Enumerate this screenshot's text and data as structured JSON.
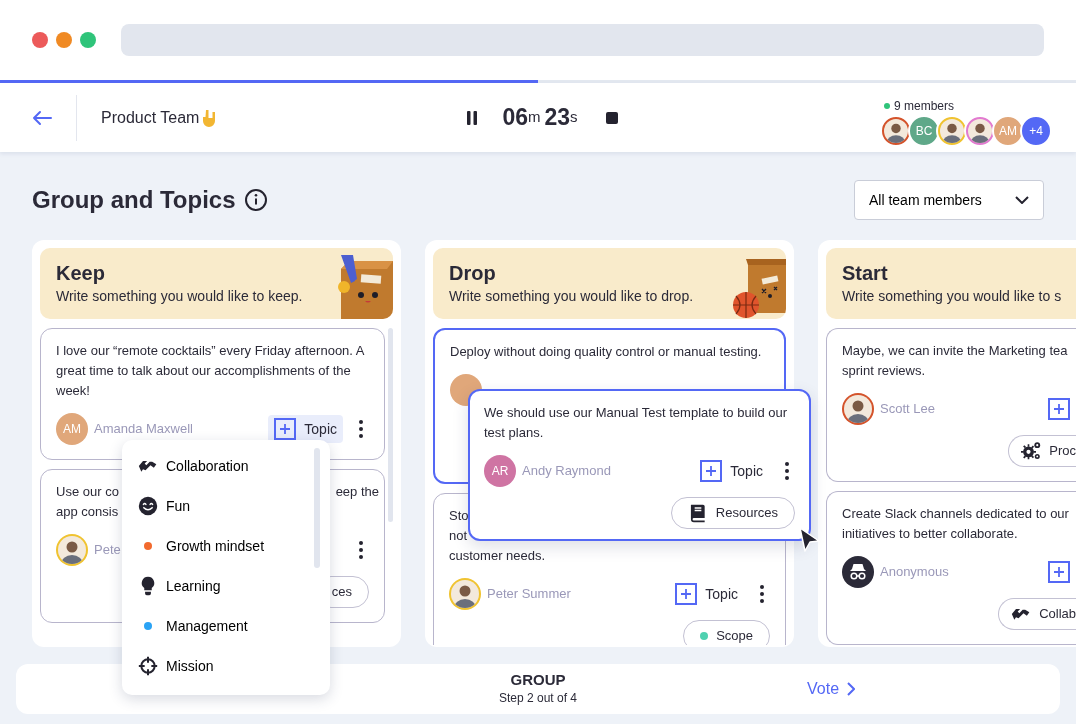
{
  "browser": {
    "dots": [
      {
        "color": "#ec5a5a"
      },
      {
        "color": "#f08a24"
      },
      {
        "color": "#2fc47a"
      }
    ]
  },
  "progress": {
    "level": 0.5
  },
  "header": {
    "title": "Product Team",
    "timer": {
      "minutes": "06",
      "minutes_unit": "m",
      "seconds": "23",
      "seconds_unit": "s"
    },
    "members": {
      "label": "9 members",
      "avatars": [
        {
          "kind": "photo",
          "color": "#d4532b"
        },
        {
          "kind": "initials",
          "initials": "BC",
          "color": "#5fa889"
        },
        {
          "kind": "photo",
          "color": "#f0c330"
        },
        {
          "kind": "photo",
          "color": "#e27ad0"
        },
        {
          "kind": "initials",
          "initials": "AM",
          "color": "#e0a77a"
        },
        {
          "kind": "initials",
          "initials": "+4",
          "color": "#5468f5"
        }
      ]
    }
  },
  "page": {
    "title": "Group and Topics",
    "filter": {
      "value": "All team members"
    }
  },
  "columns": [
    {
      "title": "Keep",
      "subtitle": "Write something you would like to keep.",
      "cards": [
        {
          "text": "I love our “remote cocktails” every Friday afternoon. A great time to talk about our accomplishments of the week!",
          "selected": false,
          "author": {
            "kind": "initials",
            "initials": "AM",
            "color": "#e0a77a",
            "name": "Amanda Maxwell"
          },
          "topic": {
            "label": "Topic",
            "expanded": true
          },
          "more": true
        },
        {
          "fragments": [
            [
              "Use our co",
              "eep the"
            ],
            [
              "app consis"
            ]
          ],
          "selected": false,
          "author": {
            "kind": "photo",
            "color": "#f0c330",
            "name": "Pete"
          },
          "more": true,
          "tag": {
            "label": "ces"
          }
        }
      ]
    },
    {
      "title": "Drop",
      "subtitle": "Write something you would like to drop.",
      "cards": [
        {
          "text": "Deploy without doing quality control or manual testing.",
          "selected": true,
          "author": {
            "kind": "initials",
            "color": "#e0a77a"
          }
        },
        {
          "fragments": [
            [
              "Sto"
            ],
            [
              "not"
            ],
            [
              "customer needs."
            ]
          ],
          "selected": false,
          "author": {
            "kind": "photo",
            "color": "#f0c330",
            "name": "Peter Summer"
          },
          "topic": {
            "label": "Topic",
            "expanded": false
          },
          "more": true,
          "tag": {
            "label": "Scope",
            "kind": "dot",
            "color": "#4fd1b0"
          }
        }
      ]
    },
    {
      "title": "Start",
      "subtitle": "Write something you would like to s",
      "cards": [
        {
          "fragments": [
            [
              "Maybe, we can invite the Marketing tea"
            ],
            [
              "sprint reviews."
            ]
          ],
          "selected": false,
          "author": {
            "kind": "photo",
            "color": "#d4532b",
            "name": "Scott Lee"
          },
          "topic": {
            "expanded": false
          },
          "tag": {
            "label": "Proc",
            "kind": "gears"
          }
        },
        {
          "fragments": [
            [
              "Create Slack channels dedicated to our"
            ],
            [
              "initiatives to better collaborate."
            ]
          ],
          "selected": false,
          "author": {
            "kind": "anonymous",
            "name": "Anonymous"
          },
          "topic": {
            "expanded": false
          },
          "tag": {
            "label": "Collab",
            "kind": "handshake"
          }
        }
      ]
    }
  ],
  "topic_menu": {
    "items": [
      {
        "label": "Collaboration",
        "kind": "handshake"
      },
      {
        "label": "Fun",
        "kind": "smiley"
      },
      {
        "label": "Growth mindset",
        "kind": "dot",
        "color": "#f26a2e"
      },
      {
        "label": "Learning",
        "kind": "bulb"
      },
      {
        "label": "Management",
        "kind": "dot",
        "color": "#2aa3f5"
      },
      {
        "label": "Mission",
        "kind": "crosshair"
      }
    ]
  },
  "dragged_card": {
    "text": "We should use our Manual Test template to build our test plans.",
    "author": {
      "kind": "initials",
      "initials": "AR",
      "color": "#cf74a3",
      "name": "Andy Raymond"
    },
    "topic": {
      "label": "Topic",
      "expanded": false
    },
    "more": true,
    "tag": {
      "label": "Resources",
      "kind": "book"
    }
  },
  "footer": {
    "step_title": "GROUP",
    "step_label": "Step 2 out of 4",
    "next": "Vote"
  }
}
